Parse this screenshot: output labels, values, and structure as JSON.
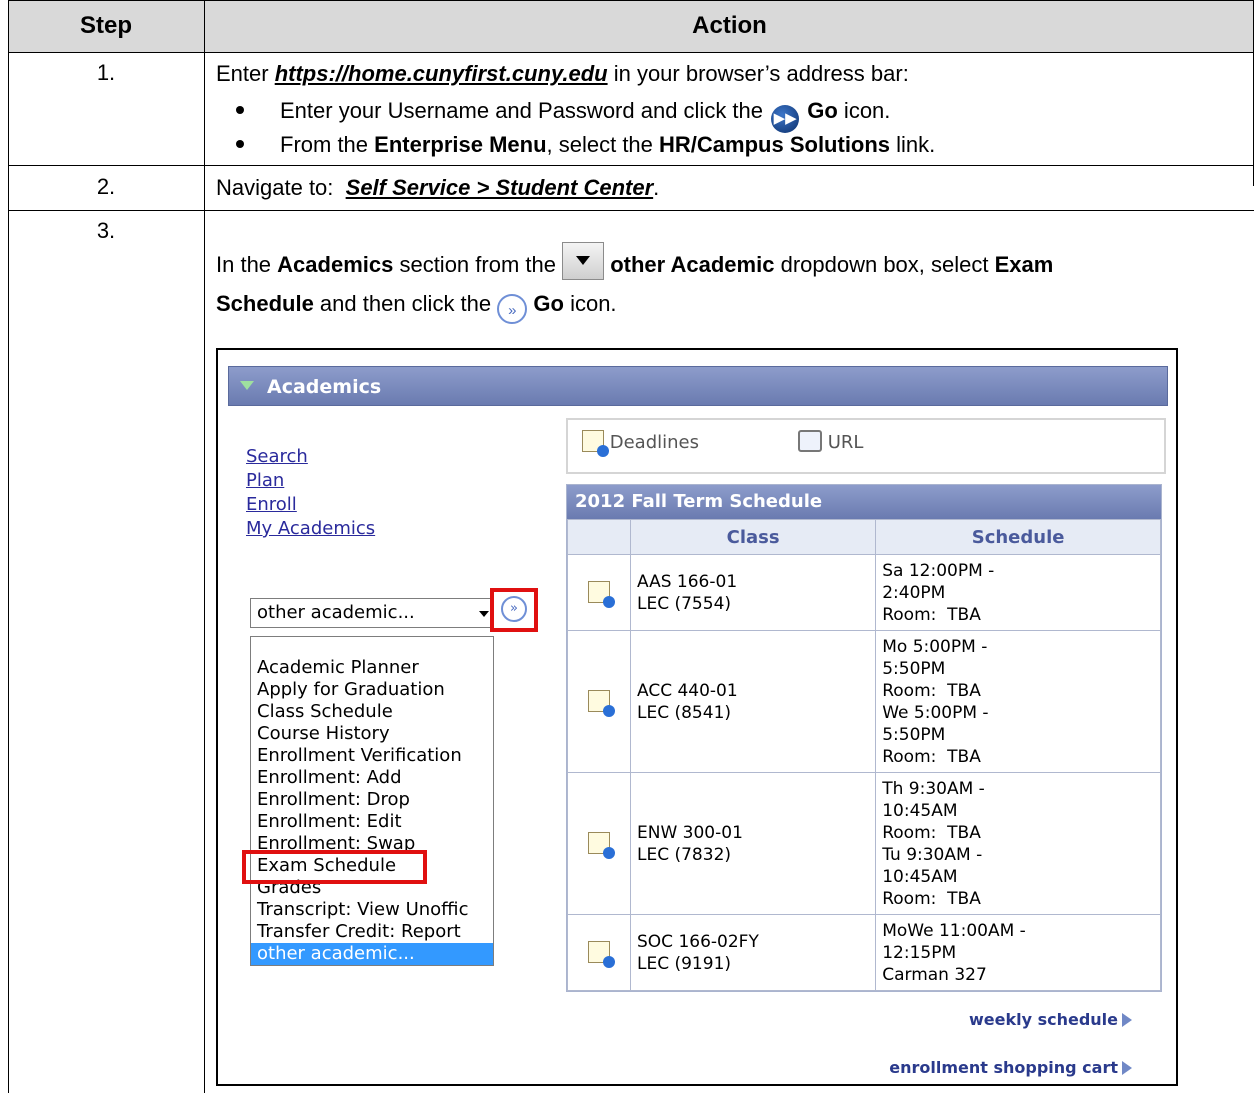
{
  "table": {
    "header_step": "Step",
    "header_action": "Action"
  },
  "row1": {
    "step": "1.",
    "enter": "Enter ",
    "url": "https://home.cunyfirst.cuny.edu",
    "after_url": " in your browser’s address bar:",
    "b1_pre": "Enter your Username and Password and click the ",
    "b1_go": "Go",
    "b1_post": " icon.",
    "b2_pre": "From the ",
    "b2_menu": "Enterprise Menu",
    "b2_mid": ", select the ",
    "b2_link": "HR/Campus Solutions",
    "b2_post": " link."
  },
  "row2": {
    "step": "2.",
    "pre": "Navigate to:  ",
    "path": "Self Service > Student Center",
    "post": "."
  },
  "row3": {
    "step": "3.",
    "p1": "In the ",
    "academics": "Academics",
    "p2": " section from the ",
    "other": "other Academic",
    "p3": " dropdown box, select ",
    "exam": "Exam",
    "schedule": "Schedule",
    "p4": " and then click the ",
    "go": "Go",
    "p5": " icon."
  },
  "screenshot": {
    "section_title": "Academics",
    "links": [
      "Search",
      "Plan",
      "Enroll",
      "My Academics"
    ],
    "select_value": "other academic...",
    "options": [
      "Academic Planner",
      "Apply for Graduation",
      "Class Schedule",
      "Course History",
      "Enrollment Verification",
      "Enrollment: Add",
      "Enrollment: Drop",
      "Enrollment: Edit",
      "Enrollment: Swap",
      "Exam Schedule",
      "Grades",
      "Transcript: View Unoffic",
      "Transfer Credit: Report"
    ],
    "selected_option": "other academic...",
    "deadlines": "Deadlines",
    "url": "URL",
    "term_title": "2012 Fall Term Schedule",
    "col_class": "Class",
    "col_schedule": "Schedule",
    "classes": [
      {
        "course": "AAS 166-01",
        "section": "LEC (7554)",
        "schedule": [
          "Sa 12:00PM -",
          "2:40PM",
          "Room:  TBA"
        ]
      },
      {
        "course": "ACC 440-01",
        "section": "LEC (8541)",
        "schedule": [
          "Mo 5:00PM -",
          "5:50PM",
          "Room:  TBA",
          "We 5:00PM -",
          "5:50PM",
          "Room:  TBA"
        ]
      },
      {
        "course": "ENW 300-01",
        "section": "LEC (7832)",
        "schedule": [
          "Th 9:30AM -",
          "10:45AM",
          "Room:  TBA",
          "Tu 9:30AM -",
          "10:45AM",
          "Room:  TBA"
        ]
      },
      {
        "course": "SOC 166-02FY",
        "section": "LEC (9191)",
        "schedule": [
          "MoWe 11:00AM -",
          "12:15PM",
          "Carman 327"
        ]
      }
    ],
    "weekly_schedule": "weekly schedule",
    "shopping_cart": "enrollment shopping cart"
  }
}
